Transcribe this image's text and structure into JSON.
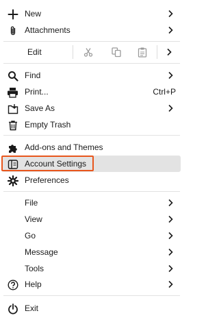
{
  "menu": {
    "new": {
      "label": "New",
      "icon": "plus-icon"
    },
    "attachments": {
      "label": "Attachments",
      "icon": "paperclip-icon"
    },
    "edit": {
      "label": "Edit",
      "cut_icon": "scissors-icon",
      "copy_icon": "copy-icon",
      "paste_icon": "paste-icon"
    },
    "find": {
      "label": "Find",
      "icon": "magnifier-icon"
    },
    "print": {
      "label": "Print...",
      "shortcut": "Ctrl+P",
      "icon": "printer-icon"
    },
    "save_as": {
      "label": "Save As",
      "icon": "save-as-icon"
    },
    "empty_trash": {
      "label": "Empty Trash",
      "icon": "trash-icon"
    },
    "addons": {
      "label": "Add-ons and Themes",
      "icon": "puzzle-icon"
    },
    "account_settings": {
      "label": "Account Settings",
      "icon": "account-card-icon"
    },
    "preferences": {
      "label": "Preferences",
      "icon": "gear-icon"
    },
    "file": {
      "label": "File"
    },
    "view": {
      "label": "View"
    },
    "go": {
      "label": "Go"
    },
    "message": {
      "label": "Message"
    },
    "tools": {
      "label": "Tools"
    },
    "help": {
      "label": "Help",
      "icon": "help-circle-icon"
    },
    "exit": {
      "label": "Exit",
      "icon": "power-icon"
    }
  },
  "colors": {
    "highlight_background": "#e3e3e3",
    "focus_outline": "#e8561c",
    "disabled_icon": "#9a9a9a"
  }
}
